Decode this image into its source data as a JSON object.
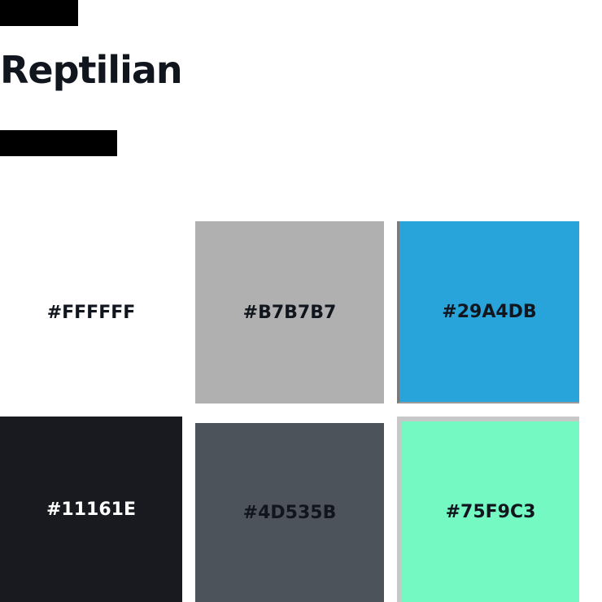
{
  "header": {
    "title": "Reptilian"
  },
  "swatches": [
    {
      "label": "#FFFFFF",
      "color": "#FFFFFF",
      "text_color": "#11161E"
    },
    {
      "label": "#B7B7B7",
      "color": "#B0B0B0",
      "text_color": "#11161E"
    },
    {
      "label": "#29A4DB",
      "color": "#29A4DB",
      "text_color": "#11161E"
    },
    {
      "label": "#11161E",
      "color": "#181A20",
      "text_color": "#FFFFFF"
    },
    {
      "label": "#4D535B",
      "color": "#4D535B",
      "text_color": "#11161E"
    },
    {
      "label": "#75F9C3",
      "color": "#75F9C3",
      "text_color": "#11161E"
    }
  ]
}
